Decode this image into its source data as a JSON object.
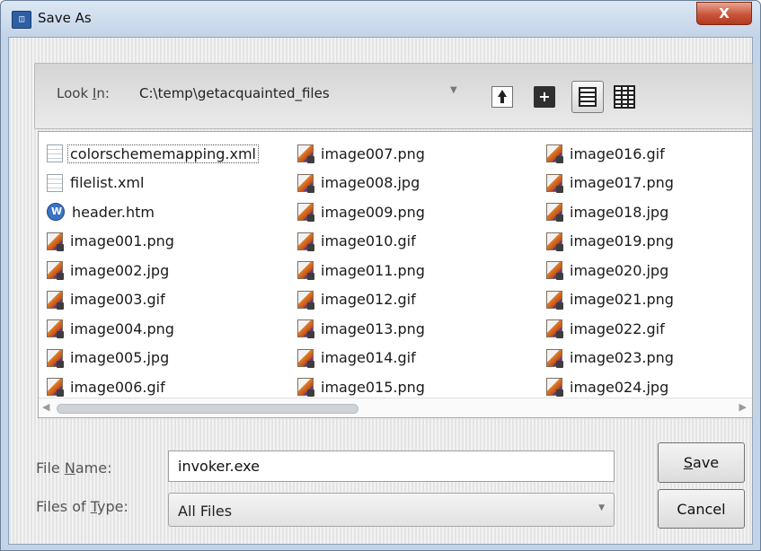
{
  "window": {
    "title": "Save As",
    "close_label": "X"
  },
  "toolbar": {
    "look_in_label": "Look In:",
    "look_in_value": "C:\\temp\\getacquainted_files",
    "icons": [
      "up-folder-icon",
      "new-folder-icon",
      "list-view-icon",
      "details-view-icon"
    ]
  },
  "file_list": {
    "columns": [
      [
        {
          "name": "colorschememapping.xml",
          "icon": "generic"
        },
        {
          "name": "filelist.xml",
          "icon": "generic"
        },
        {
          "name": "header.htm",
          "icon": "htm"
        },
        {
          "name": "image001.png",
          "icon": "image"
        },
        {
          "name": "image002.jpg",
          "icon": "image"
        },
        {
          "name": "image003.gif",
          "icon": "image"
        },
        {
          "name": "image004.png",
          "icon": "image"
        },
        {
          "name": "image005.jpg",
          "icon": "image"
        },
        {
          "name": "image006.gif",
          "icon": "image"
        }
      ],
      [
        {
          "name": "image007.png",
          "icon": "image"
        },
        {
          "name": "image008.jpg",
          "icon": "image"
        },
        {
          "name": "image009.png",
          "icon": "image"
        },
        {
          "name": "image010.gif",
          "icon": "image"
        },
        {
          "name": "image011.png",
          "icon": "image"
        },
        {
          "name": "image012.gif",
          "icon": "image"
        },
        {
          "name": "image013.png",
          "icon": "image"
        },
        {
          "name": "image014.gif",
          "icon": "image"
        },
        {
          "name": "image015.png",
          "icon": "image"
        }
      ],
      [
        {
          "name": "image016.gif",
          "icon": "image"
        },
        {
          "name": "image017.png",
          "icon": "image"
        },
        {
          "name": "image018.jpg",
          "icon": "image"
        },
        {
          "name": "image019.png",
          "icon": "image"
        },
        {
          "name": "image020.jpg",
          "icon": "image"
        },
        {
          "name": "image021.png",
          "icon": "image"
        },
        {
          "name": "image022.gif",
          "icon": "image"
        },
        {
          "name": "image023.png",
          "icon": "image"
        },
        {
          "name": "image024.jpg",
          "icon": "image"
        }
      ]
    ]
  },
  "form": {
    "file_name_label_pre": "File ",
    "file_name_label_ul": "N",
    "file_name_label_post": "ame:",
    "file_name_value": "invoker.exe",
    "files_of_type_label_pre": "Files of ",
    "files_of_type_label_ul": "T",
    "files_of_type_label_post": "ype:",
    "files_of_type_value": "All Files"
  },
  "buttons": {
    "save_ul": "S",
    "save_rest": "ave",
    "cancel": "Cancel"
  }
}
